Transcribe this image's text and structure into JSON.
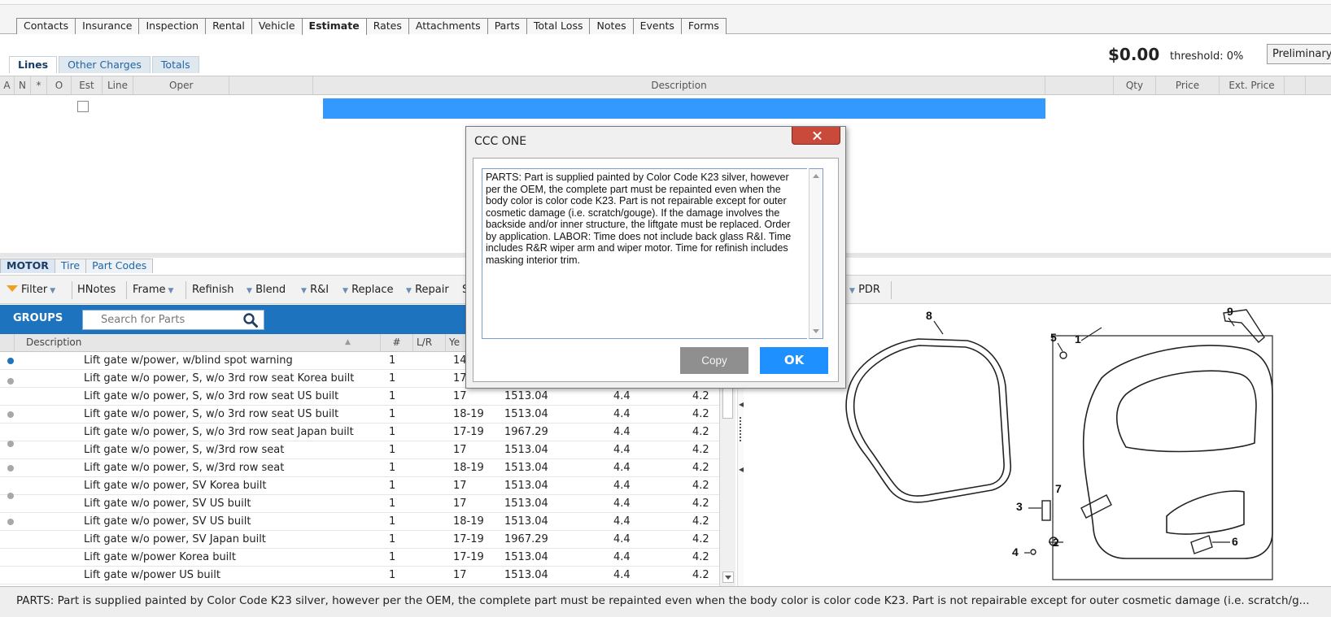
{
  "main_tabs": [
    {
      "label": "Contacts"
    },
    {
      "label": "Insurance"
    },
    {
      "label": "Inspection"
    },
    {
      "label": "Rental"
    },
    {
      "label": "Vehicle"
    },
    {
      "label": "Estimate"
    },
    {
      "label": "Rates"
    },
    {
      "label": "Attachments"
    },
    {
      "label": "Parts"
    },
    {
      "label": "Total Loss"
    },
    {
      "label": "Notes"
    },
    {
      "label": "Events"
    },
    {
      "label": "Forms"
    }
  ],
  "estimate": {
    "total": "$0.00",
    "threshold": "threshold: 0%",
    "status_select": "Preliminary"
  },
  "sub_tabs": [
    {
      "label": "Lines"
    },
    {
      "label": "Other Charges"
    },
    {
      "label": "Totals"
    }
  ],
  "lines_columns": {
    "a": "A",
    "n": "N",
    "star": "*",
    "o": "O",
    "est": "Est",
    "line": "Line",
    "oper": "Oper",
    "description": "Description",
    "qty": "Qty",
    "price": "Price",
    "ext_price": "Ext. Price"
  },
  "motor_tabs": [
    {
      "label": "MOTOR"
    },
    {
      "label": "Tire"
    },
    {
      "label": "Part Codes"
    }
  ],
  "toolbar": {
    "filter": "Filter",
    "hnotes": "HNotes",
    "frame": "Frame",
    "refinish": "Refinish",
    "blend": "Blend",
    "rni": "R&I",
    "replace": "Replace",
    "repair": "Repair",
    "s_partial": "S",
    "pdr": "PDR"
  },
  "groups": {
    "label": "GROUPS",
    "search_placeholder": "Search for Parts"
  },
  "parts_grid": {
    "columns": {
      "description": "Description",
      "num": "#",
      "lr": "L/R",
      "year": "Ye"
    },
    "rows": [
      {
        "desc": "Lift gate w/power, w/blind spot warning",
        "num": "1",
        "year": "14",
        "price": "",
        "labor": "",
        "paint": "",
        "dot": "blue"
      },
      {
        "desc": "Lift gate w/o power, S, w/o 3rd row seat Korea built",
        "num": "1",
        "year": "17",
        "price": "",
        "labor": "",
        "paint": "",
        "dot": "gray"
      },
      {
        "desc": "Lift gate w/o power, S, w/o 3rd row seat US built",
        "num": "1",
        "year": "17",
        "price": "1513.04",
        "labor": "4.4",
        "paint": "4.2",
        "dot": "none"
      },
      {
        "desc": "Lift gate w/o power, S, w/o 3rd row seat US built",
        "num": "1",
        "year": "18-19",
        "price": "1513.04",
        "labor": "4.4",
        "paint": "4.2",
        "dot": "gray"
      },
      {
        "desc": "Lift gate w/o power, S, w/o 3rd row seat Japan built",
        "num": "1",
        "year": "17-19",
        "price": "1967.29",
        "labor": "4.4",
        "paint": "4.2",
        "dot": "none"
      },
      {
        "desc": "Lift gate w/o power, S, w/3rd row seat",
        "num": "1",
        "year": "17",
        "price": "1513.04",
        "labor": "4.4",
        "paint": "4.2",
        "dot": "gray"
      },
      {
        "desc": "Lift gate w/o power, S, w/3rd row seat",
        "num": "1",
        "year": "18-19",
        "price": "1513.04",
        "labor": "4.4",
        "paint": "4.2",
        "dot": "gray"
      },
      {
        "desc": "Lift gate w/o power, SV Korea built",
        "num": "1",
        "year": "17",
        "price": "1513.04",
        "labor": "4.4",
        "paint": "4.2",
        "dot": "none"
      },
      {
        "desc": "Lift gate w/o power, SV US built",
        "num": "1",
        "year": "17",
        "price": "1513.04",
        "labor": "4.4",
        "paint": "4.2",
        "dot": "gray"
      },
      {
        "desc": "Lift gate w/o power, SV US built",
        "num": "1",
        "year": "18-19",
        "price": "1513.04",
        "labor": "4.4",
        "paint": "4.2",
        "dot": "gray"
      },
      {
        "desc": "Lift gate w/o power, SV Japan built",
        "num": "1",
        "year": "17-19",
        "price": "1967.29",
        "labor": "4.4",
        "paint": "4.2",
        "dot": "none"
      },
      {
        "desc": "Lift gate w/power Korea built",
        "num": "1",
        "year": "17-19",
        "price": "1513.04",
        "labor": "4.4",
        "paint": "4.2",
        "dot": "none"
      },
      {
        "desc": "Lift gate w/power US built",
        "num": "1",
        "year": "17",
        "price": "1513.04",
        "labor": "4.4",
        "paint": "4.2",
        "dot": "none"
      }
    ]
  },
  "diagram": {
    "callouts": [
      "8",
      "5",
      "1",
      "9",
      "7",
      "3",
      "2",
      "4",
      "6"
    ]
  },
  "dialog": {
    "title": "CCC ONE",
    "message": "PARTS: Part is supplied painted by Color Code K23 silver, however per the OEM, the complete part must be repainted even when the body color is color code K23. Part is not repairable except for outer cosmetic damage (i.e. scratch/gouge). If the damage involves the backside and/or inner structure, the liftgate must be replaced. Order by application. LABOR: Time does not include back glass R&I. Time includes R&R wiper arm and wiper motor. Time for refinish includes masking interior trim.",
    "copy_label": "Copy",
    "ok_label": "OK"
  },
  "status_bar": {
    "text": "PARTS: Part is supplied painted by Color Code K23 silver, however per the OEM, the complete part must be repainted even when the body color is color code K23. Part is not repairable except for outer cosmetic damage (i.e. scratch/g..."
  }
}
